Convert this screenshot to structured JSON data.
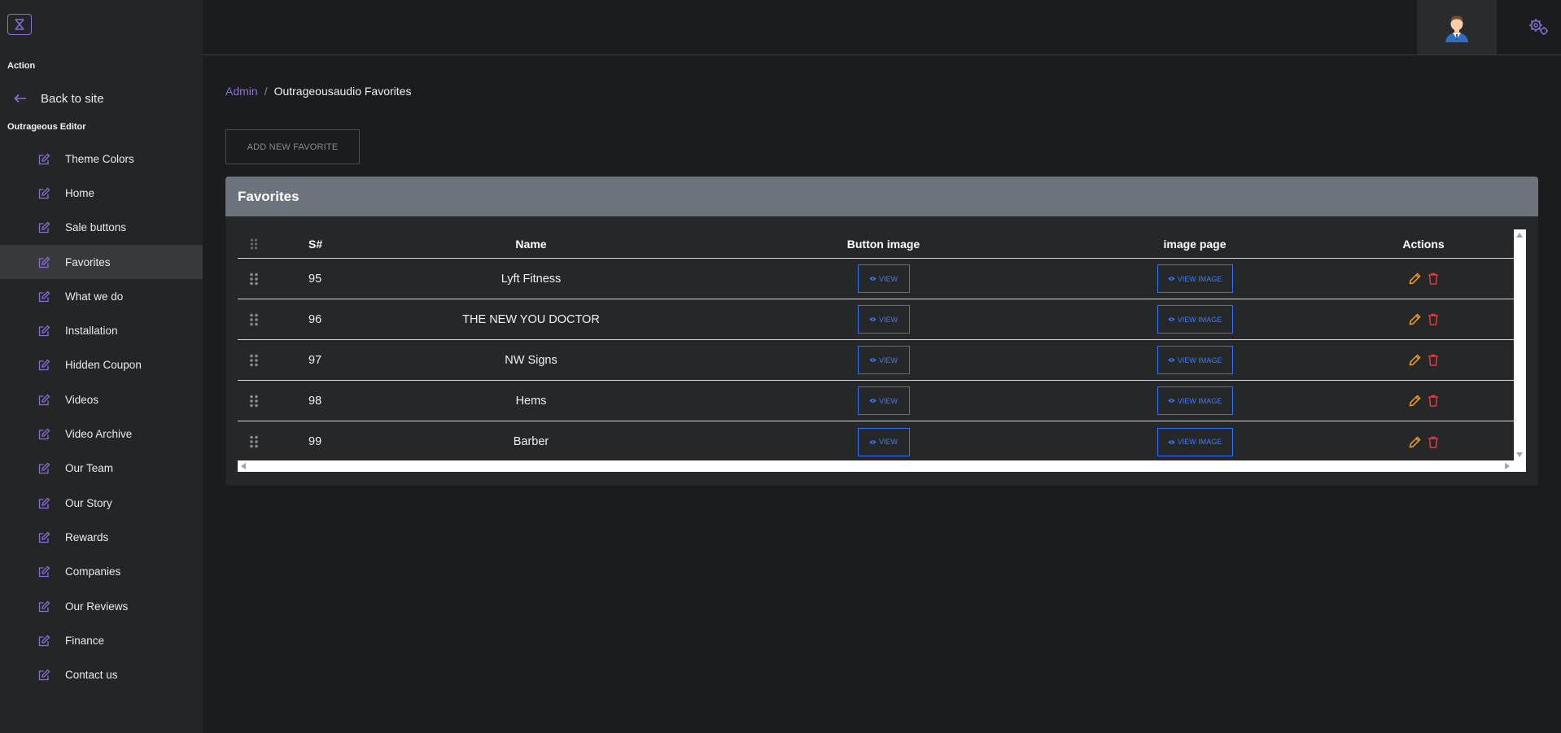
{
  "sidebar": {
    "action_label": "Action",
    "back_label": "Back to site",
    "editor_label": "Outrageous Editor",
    "items": [
      {
        "label": "Theme Colors"
      },
      {
        "label": "Home"
      },
      {
        "label": "Sale buttons"
      },
      {
        "label": "Favorites",
        "active": true
      },
      {
        "label": "What we do"
      },
      {
        "label": "Installation"
      },
      {
        "label": "Hidden Coupon"
      },
      {
        "label": "Videos"
      },
      {
        "label": "Video Archive"
      },
      {
        "label": "Our Team"
      },
      {
        "label": "Our Story"
      },
      {
        "label": "Rewards"
      },
      {
        "label": "Companies"
      },
      {
        "label": "Our Reviews"
      },
      {
        "label": "Finance"
      },
      {
        "label": "Contact us"
      }
    ]
  },
  "breadcrumb": {
    "root": "Admin",
    "separator": "/",
    "current": "Outrageousaudio Favorites"
  },
  "toolbar": {
    "add_label": "ADD NEW FAVORITE"
  },
  "card": {
    "title": "Favorites"
  },
  "table": {
    "headers": {
      "sn": "S#",
      "name": "Name",
      "button_image": "Button image",
      "image_page": "image page",
      "actions": "Actions"
    },
    "view_label": "VIEW",
    "view_image_label": "VIEW IMAGE",
    "rows": [
      {
        "sn": "95",
        "name": "Lyft Fitness"
      },
      {
        "sn": "96",
        "name": "THE NEW YOU DOCTOR"
      },
      {
        "sn": "97",
        "name": "NW Signs"
      },
      {
        "sn": "98",
        "name": "Hems"
      },
      {
        "sn": "99",
        "name": "Barber"
      }
    ]
  },
  "colors": {
    "accent": "#8b6fd6",
    "link_blue": "#2f6fff",
    "edit": "#f0a020",
    "delete": "#e0393e",
    "header_bar": "#6c737d"
  }
}
